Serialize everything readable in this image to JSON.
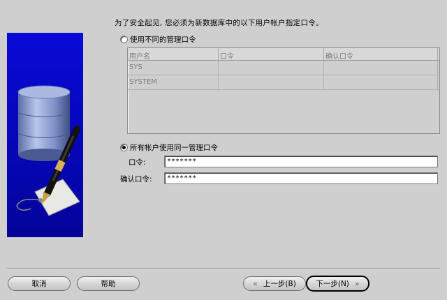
{
  "intro_text": "为了安全起见, 您必须为新数据库中的以下用户帐户指定口令。",
  "option_different": {
    "label": "使用不同的管理口令",
    "selected": false
  },
  "table": {
    "headers": [
      "用户名",
      "口令",
      "确认口令"
    ],
    "rows": [
      [
        "SYS",
        "",
        ""
      ],
      [
        "SYSTEM",
        "",
        ""
      ]
    ]
  },
  "option_same": {
    "label": "所有帐户使用同一管理口令",
    "selected": true
  },
  "password_label": "口令:",
  "password_value": "*******",
  "confirm_label": "确认口令:",
  "confirm_value": "*******",
  "buttons": {
    "cancel": "取消",
    "help": "帮助",
    "back": "上一步(B)",
    "next": "下一步(N)"
  },
  "icons": {
    "banner": "database-pen-tag-illustration",
    "back": "double-chevron-left-icon",
    "next": "double-chevron-right-icon"
  },
  "colors": {
    "banner": "#0808c8",
    "background": "#cfcfcf"
  }
}
